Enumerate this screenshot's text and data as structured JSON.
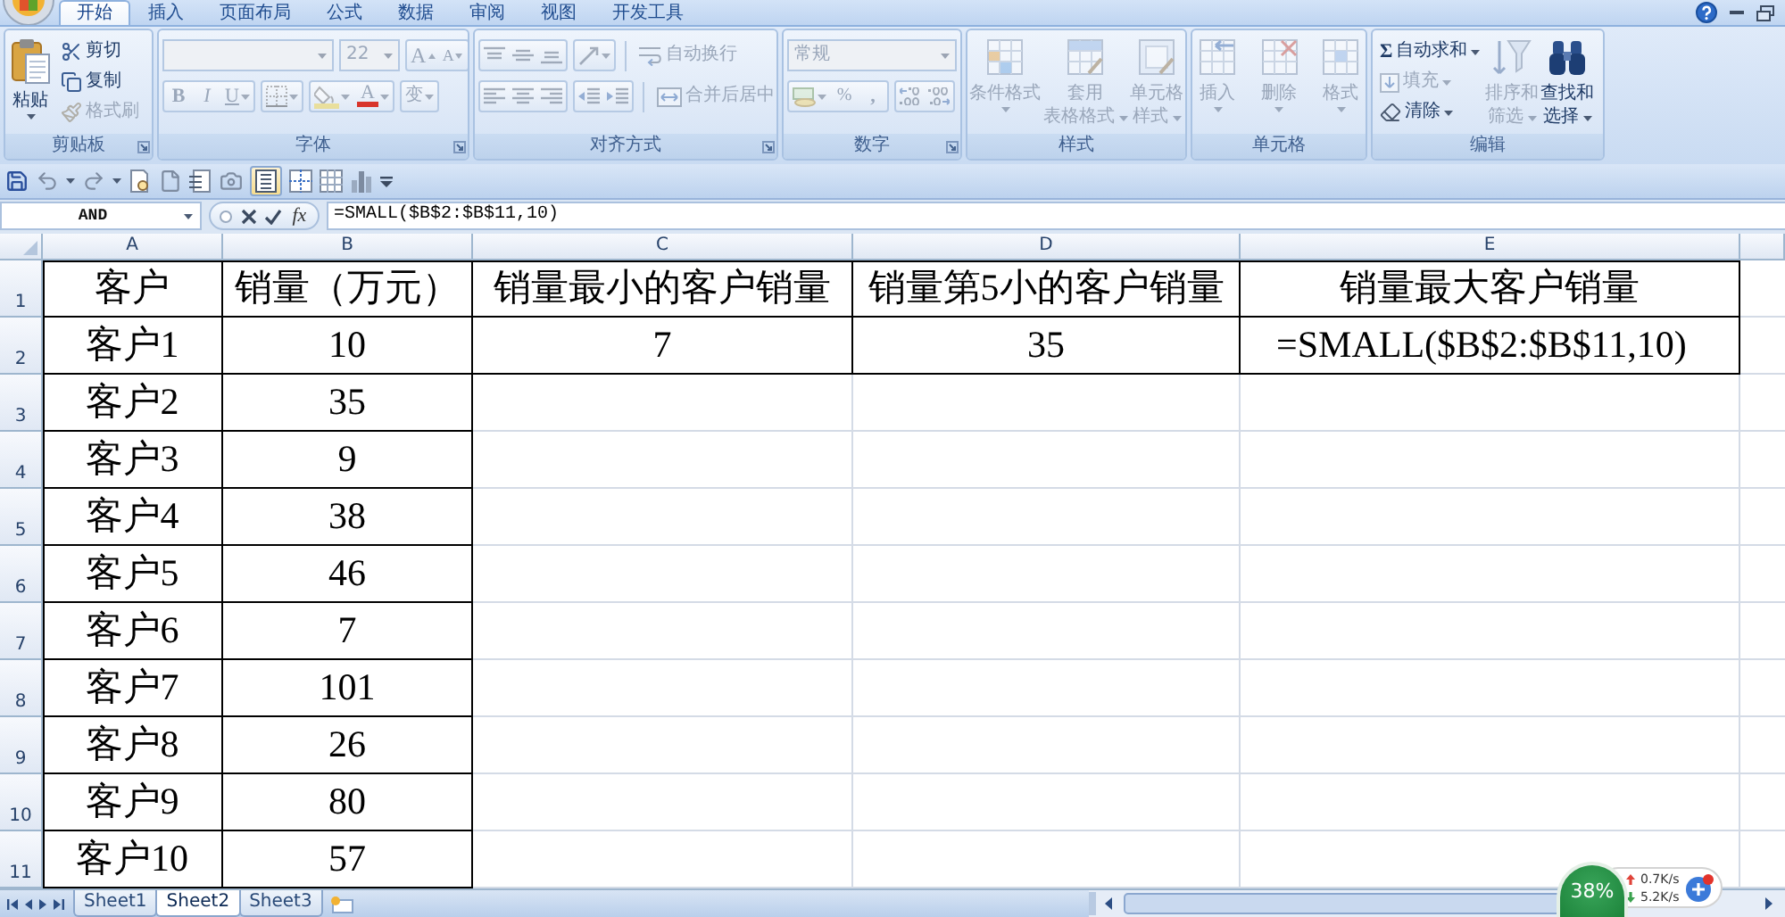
{
  "ribbon_tabs": [
    {
      "label": "开始",
      "selected": true
    },
    {
      "label": "插入",
      "selected": false
    },
    {
      "label": "页面布局",
      "selected": false
    },
    {
      "label": "公式",
      "selected": false
    },
    {
      "label": "数据",
      "selected": false
    },
    {
      "label": "审阅",
      "selected": false
    },
    {
      "label": "视图",
      "selected": false
    },
    {
      "label": "开发工具",
      "selected": false
    }
  ],
  "ribbon": {
    "clipboard": {
      "title": "剪贴板",
      "paste": {
        "label": "粘贴",
        "disabled": false
      },
      "cut": {
        "label": "剪切",
        "disabled": false
      },
      "copy": {
        "label": "复制",
        "disabled": false
      },
      "format_painter": {
        "label": "格式刷",
        "disabled": true
      }
    },
    "font": {
      "title": "字体",
      "font_size": "22",
      "grow_font": "A",
      "shrink_font": "A",
      "bold": "B",
      "italic": "I",
      "underline": "U",
      "font_color": "A",
      "phonetic": "变",
      "disabled": true
    },
    "alignment": {
      "title": "对齐方式",
      "wrap_text": "自动换行",
      "merge_center": "合并后居中",
      "disabled": true
    },
    "number": {
      "title": "数字",
      "format": "常规",
      "percent": "%",
      "comma": ",",
      "disabled": true
    },
    "styles": {
      "title": "样式",
      "conditional_format": [
        "条件格式"
      ],
      "format_as_table": [
        "套用",
        "表格格式"
      ],
      "cell_styles": [
        "单元格",
        "样式"
      ],
      "disabled": true
    },
    "cells": {
      "title": "单元格",
      "insert": "插入",
      "delete": "删除",
      "format": "格式",
      "disabled": true
    },
    "editing": {
      "title": "编辑",
      "autosum": {
        "symbol": "Σ",
        "label": "自动求和",
        "disabled": false
      },
      "fill": {
        "label": "填充",
        "disabled": true
      },
      "clear": {
        "label": "清除",
        "disabled": false
      },
      "sort_filter": {
        "lines": [
          "排序和",
          "筛选"
        ],
        "disabled": true
      },
      "find_select": {
        "lines": [
          "查找和",
          "选择"
        ],
        "disabled": false
      }
    }
  },
  "formula_bar": {
    "name_box": "AND",
    "function_button": "fx",
    "formula": "=SMALL($B$2:$B$11,10)"
  },
  "sheet": {
    "columns": [
      "A",
      "B",
      "C",
      "D",
      "E"
    ],
    "rows": [
      {
        "header": "1",
        "cells": [
          {
            "text": "客户",
            "editing": false
          },
          {
            "text": "销量（万元）",
            "editing": false
          },
          {
            "text": "销量最小的客户销量",
            "editing": false
          },
          {
            "text": "销量第5小的客户销量",
            "editing": false
          },
          {
            "text": "销量最大客户销量",
            "editing": false
          }
        ]
      },
      {
        "header": "2",
        "cells": [
          {
            "text": "客户1",
            "editing": false
          },
          {
            "text": "10",
            "editing": false
          },
          {
            "text": "7",
            "editing": false
          },
          {
            "text": "35",
            "editing": false
          },
          {
            "text": "=SMALL($B$2:$B$11,10)",
            "editing": true
          }
        ]
      },
      {
        "header": "3",
        "cells": [
          {
            "text": "客户2",
            "editing": false
          },
          {
            "text": "35",
            "editing": false
          }
        ]
      },
      {
        "header": "4",
        "cells": [
          {
            "text": "客户3",
            "editing": false
          },
          {
            "text": "9",
            "editing": false
          }
        ]
      },
      {
        "header": "5",
        "cells": [
          {
            "text": "客户4",
            "editing": false
          },
          {
            "text": "38",
            "editing": false
          }
        ]
      },
      {
        "header": "6",
        "cells": [
          {
            "text": "客户5",
            "editing": false
          },
          {
            "text": "46",
            "editing": false
          }
        ]
      },
      {
        "header": "7",
        "cells": [
          {
            "text": "客户6",
            "editing": false
          },
          {
            "text": "7",
            "editing": false
          }
        ]
      },
      {
        "header": "8",
        "cells": [
          {
            "text": "客户7",
            "editing": false
          },
          {
            "text": "101",
            "editing": false
          }
        ]
      },
      {
        "header": "9",
        "cells": [
          {
            "text": "客户8",
            "editing": false
          },
          {
            "text": "26",
            "editing": false
          }
        ]
      },
      {
        "header": "10",
        "cells": [
          {
            "text": "客户9",
            "editing": false
          },
          {
            "text": "80",
            "editing": false
          }
        ]
      },
      {
        "header": "11",
        "cells": [
          {
            "text": "客户10",
            "editing": false
          },
          {
            "text": "57",
            "editing": false
          }
        ]
      }
    ]
  },
  "sheet_tabs": [
    {
      "label": "Sheet1",
      "selected": false
    },
    {
      "label": "Sheet2",
      "selected": true
    },
    {
      "label": "Sheet3",
      "selected": false
    }
  ],
  "speed_widget": {
    "usage": "38%",
    "upload": "0.7K/s",
    "download": "5.2K/s"
  }
}
